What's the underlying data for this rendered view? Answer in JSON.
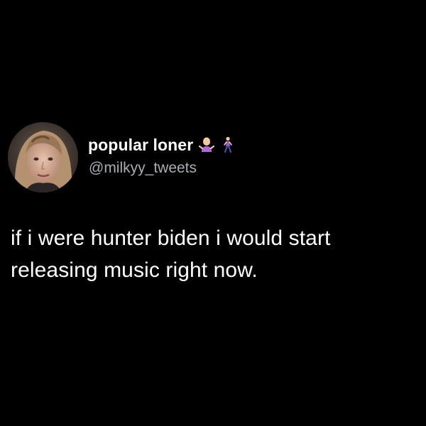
{
  "tweet": {
    "display_name": "popular loner",
    "handle": "@milkyy_tweets",
    "name_emojis": [
      "woman-shrugging-emoji-icon",
      "woman-walking-emoji-icon"
    ],
    "text_lines": [
      "if i were hunter biden i would start",
      "releasing music right now."
    ]
  },
  "colors": {
    "background": "#000000",
    "primary_text": "#ffffff",
    "secondary_text": "#a7adb3"
  }
}
